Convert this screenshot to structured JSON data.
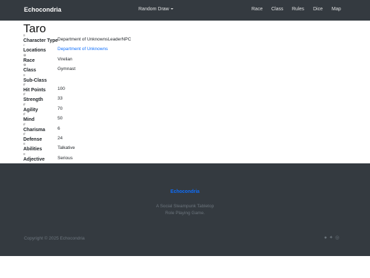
{
  "nav": {
    "brand": "Echocondria",
    "dropdown_label": "Random Draw",
    "links": [
      "Race",
      "Class",
      "Rules",
      "Dice",
      "Map"
    ]
  },
  "character": {
    "name": "Taro",
    "fields": [
      {
        "icon": "≡",
        "label": "Character Type",
        "value": "Department of UnknownsLeaderNPC",
        "link": false
      },
      {
        "icon": "⌐",
        "label": "Locations",
        "value": "Department of Unknowns",
        "link": true
      },
      {
        "icon": "⊕",
        "label": "Race",
        "value": "Virelian",
        "link": false
      },
      {
        "icon": "⊕",
        "label": "Class",
        "value": "Gymnast",
        "link": false
      },
      {
        "icon": "≡",
        "label": "Sub-Class",
        "value": "",
        "link": false
      },
      {
        "icon": "#",
        "label": "Hit Points",
        "value": "100",
        "link": false
      },
      {
        "icon": "#",
        "label": "Strength",
        "value": "33",
        "link": false
      },
      {
        "icon": "#",
        "label": "Agility",
        "value": "70",
        "link": false
      },
      {
        "icon": "#",
        "label": "Mind",
        "value": "50",
        "link": false
      },
      {
        "icon": "#",
        "label": "Charisma",
        "value": "6",
        "link": false
      },
      {
        "icon": "#",
        "label": "Defense",
        "value": "24",
        "link": false
      },
      {
        "icon": "≡",
        "label": "Abilities",
        "value": "Talkative",
        "link": false
      },
      {
        "icon": "≡",
        "label": "Adjective",
        "value": "Serious",
        "link": false
      }
    ]
  },
  "footer": {
    "brand": "Echocondria",
    "tagline_line1": "A Social Steampunk Tabletop",
    "tagline_line2": "Role Playing Game.",
    "copyright": "Copyright © 2025 Echocondria",
    "social_icons": [
      "github-icon",
      "twitter-icon",
      "instagram-icon"
    ]
  },
  "colors": {
    "navbar": "#343a40",
    "link": "#0d6efd",
    "muted": "#6c757d"
  }
}
